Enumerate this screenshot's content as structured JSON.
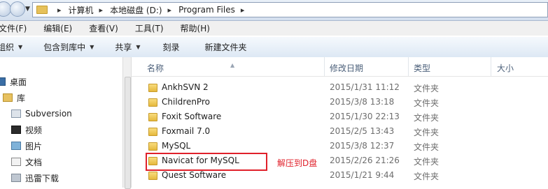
{
  "address": {
    "crumbs": [
      "计算机",
      "本地磁盘 (D:)",
      "Program Files"
    ]
  },
  "menu": [
    "文件(F)",
    "编辑(E)",
    "查看(V)",
    "工具(T)",
    "帮助(H)"
  ],
  "toolbar": {
    "organize": "组织",
    "include": "包含到库中",
    "share": "共享",
    "burn": "刻录",
    "new_folder": "新建文件夹"
  },
  "nav": {
    "desktop": "桌面",
    "libraries": "库",
    "subversion": "Subversion",
    "videos": "视频",
    "pictures": "图片",
    "documents": "文档",
    "thunder": "迅雷下载"
  },
  "columns": {
    "name": "名称",
    "date": "修改日期",
    "type": "类型",
    "size": "大小"
  },
  "files": [
    {
      "name": "AnkhSVN 2",
      "date": "2015/1/31 11:12",
      "type": "文件夹"
    },
    {
      "name": "ChildrenPro",
      "date": "2015/3/8 13:18",
      "type": "文件夹"
    },
    {
      "name": "Foxit Software",
      "date": "2015/1/30 22:13",
      "type": "文件夹"
    },
    {
      "name": "Foxmail 7.0",
      "date": "2015/2/5 13:43",
      "type": "文件夹"
    },
    {
      "name": "MySQL",
      "date": "2015/3/8 12:37",
      "type": "文件夹"
    },
    {
      "name": "Navicat for MySQL",
      "date": "2015/2/26 21:26",
      "type": "文件夹"
    },
    {
      "name": "Quest Software",
      "date": "2015/1/21 9:44",
      "type": "文件夹"
    }
  ],
  "annotation": "解压到D盘",
  "colors": {
    "highlight": "#e0202a"
  }
}
